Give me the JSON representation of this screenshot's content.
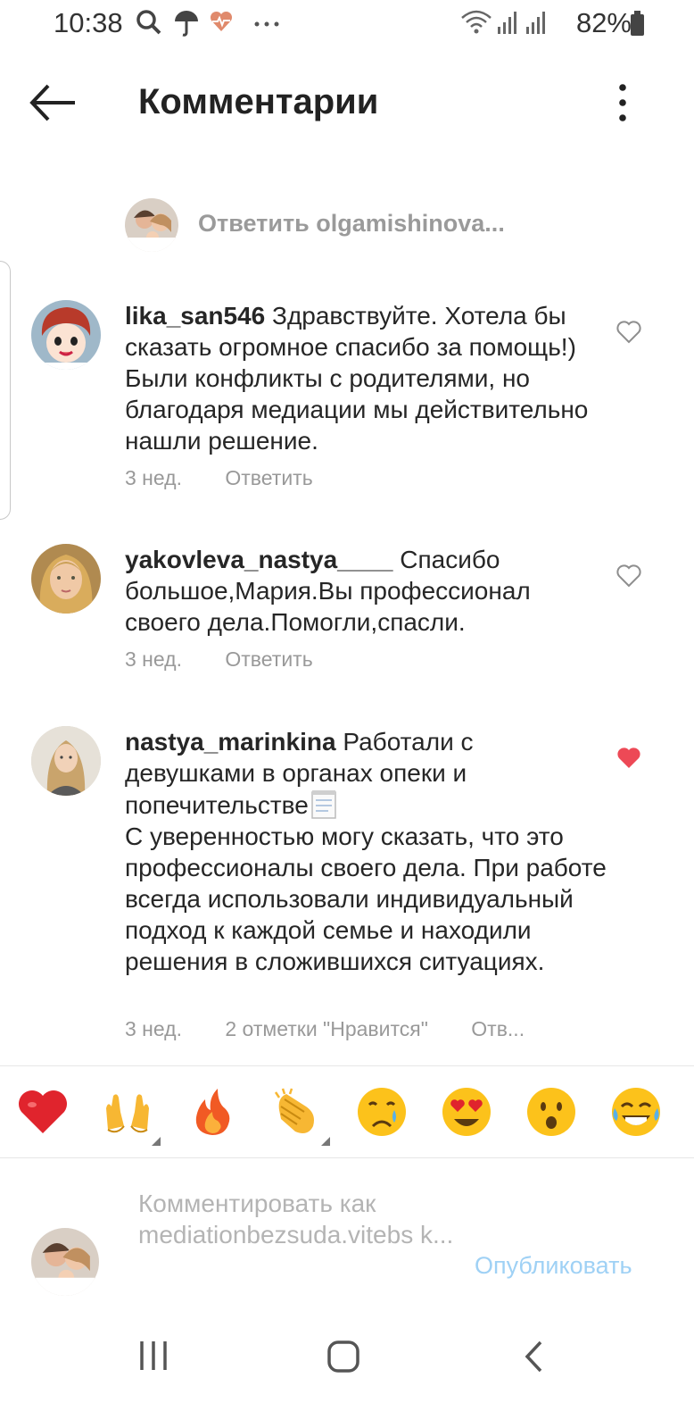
{
  "status": {
    "time": "10:38",
    "battery": "82%",
    "icons": [
      "search-icon",
      "umbrella-icon",
      "heart-rate-icon",
      "more-dots-icon",
      "wifi-icon",
      "signal-icon",
      "signal-icon-2",
      "battery-icon"
    ]
  },
  "header": {
    "title": "Комментарии",
    "back_icon": "arrow-left-icon",
    "menu_icon": "more-vertical-icon"
  },
  "reply": {
    "text": "Ответить olgamishinova..."
  },
  "comments": [
    {
      "username": "lika_san546",
      "text": "Здравствуйте. Хотела бы сказать огромное спасибо за помощь!) Были конфликты с родителями, но благодаря медиации мы действительно нашли решение.",
      "time": "3 нед.",
      "reply_label": "Ответить",
      "liked": false
    },
    {
      "username": "yakovleva_nastya____",
      "text": "Спасибо большое,Мария.Вы профессионал своего дела.Помогли,спасли.",
      "time": "3 нед.",
      "reply_label": "Ответить",
      "liked": false
    },
    {
      "username": "nastya_marinkina",
      "text": "Работали с девушками в органах опеки и попечительстве",
      "text_cont": "С уверенностью могу сказать, что это профессионалы своего дела. При работе всегда использовали индивидуальный подход к каждой семье и находили решения в сложившихся ситуациях.",
      "time": "3 нед.",
      "likes_label": "2 отметки \"Нравится\"",
      "reply_label": "Отв...",
      "liked": true
    }
  ],
  "emoji_bar": [
    "❤",
    "🙌",
    "🔥",
    "👏",
    "😢",
    "😍",
    "😮",
    "😂"
  ],
  "compose": {
    "placeholder": "Комментировать как mediationbezsuda.vitebs k...",
    "publish_label": "Опубликовать"
  },
  "colors": {
    "like_red": "#ed4956",
    "publish_blue": "#9fd1f5",
    "muted_text": "#999999"
  }
}
